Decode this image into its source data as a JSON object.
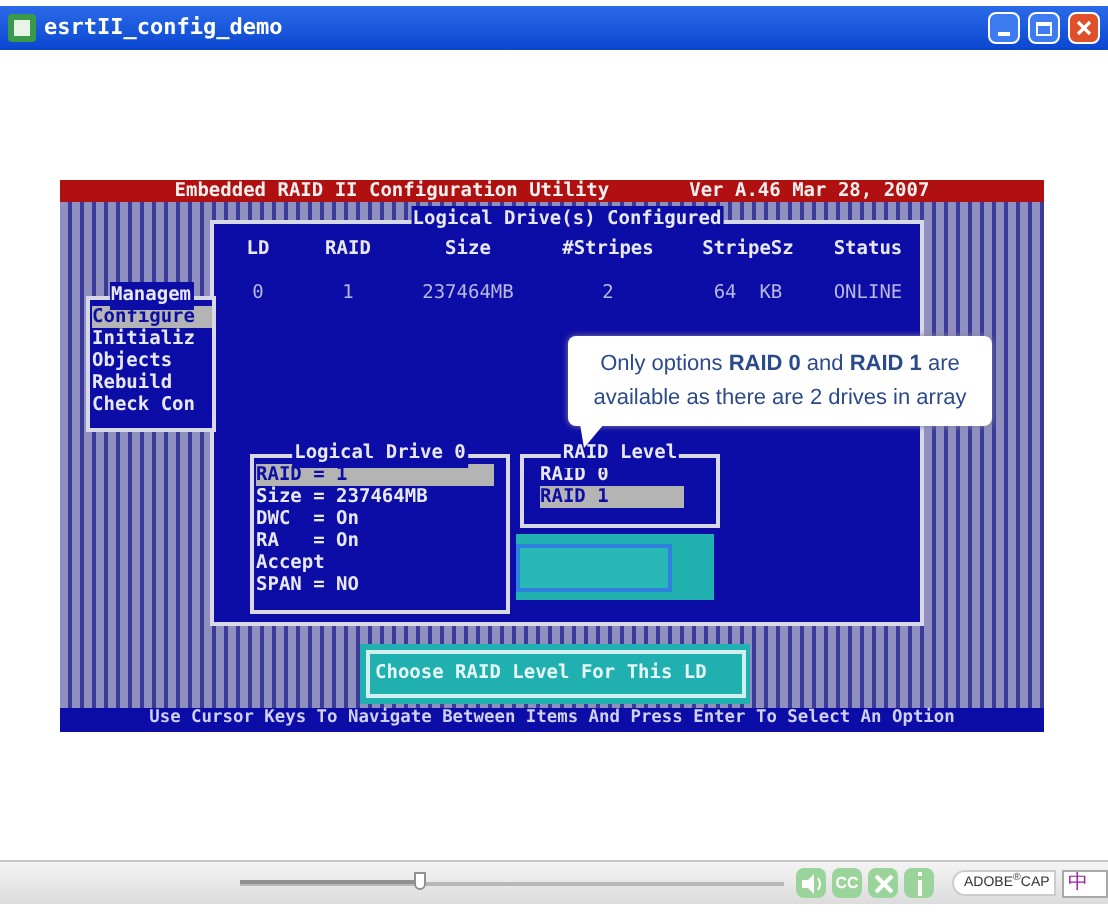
{
  "window": {
    "title": "esrtII_config_demo"
  },
  "utility": {
    "header_title": "Embedded RAID II Configuration Utility",
    "header_version": "Ver A.46 Mar 28, 2007",
    "configured_panel": {
      "title": "Logical Drive(s) Configured",
      "columns": [
        "LD",
        "RAID",
        "Size",
        "#Stripes",
        "StripeSz",
        "Status"
      ],
      "rows": [
        [
          "0",
          "1",
          "237464MB",
          "2",
          "64  KB",
          "ONLINE"
        ]
      ]
    },
    "management_menu": {
      "title": "Managem",
      "items": [
        {
          "label": "Configure",
          "selected": true
        },
        {
          "label": "Initializ",
          "selected": false
        },
        {
          "label": "Objects",
          "selected": false
        },
        {
          "label": "Rebuild",
          "selected": false
        },
        {
          "label": "Check Con",
          "selected": false
        }
      ]
    },
    "logical_drive_panel": {
      "title": "Logical Drive 0",
      "items": [
        {
          "label": "RAID = 1",
          "selected": true
        },
        {
          "label": "Size = 237464MB",
          "selected": false
        },
        {
          "label": "DWC  = On",
          "selected": false
        },
        {
          "label": "RA   = On",
          "selected": false
        },
        {
          "label": "Accept",
          "selected": false
        },
        {
          "label": "SPAN = NO",
          "selected": false
        }
      ]
    },
    "raid_level_panel": {
      "title": "RAID Level",
      "options": [
        {
          "label": "RAID 0",
          "selected": false
        },
        {
          "label": "RAID 1",
          "selected": true
        }
      ]
    },
    "hint": "Choose RAID Level For This LD",
    "status_line": "Use Cursor Keys To Navigate Between Items And Press Enter To Select An Option",
    "callout": [
      "Only options **RAID 0** and **RAID 1** are",
      "available as there are 2 drives in array"
    ]
  },
  "player": {
    "level": 0.33,
    "buttons": [
      {
        "kind": "sound"
      },
      {
        "kind": "captions",
        "label": "CC"
      },
      {
        "kind": "close"
      },
      {
        "kind": "info"
      }
    ],
    "brand": "ADOBE$^{®}$CAP",
    "ime": "中"
  }
}
